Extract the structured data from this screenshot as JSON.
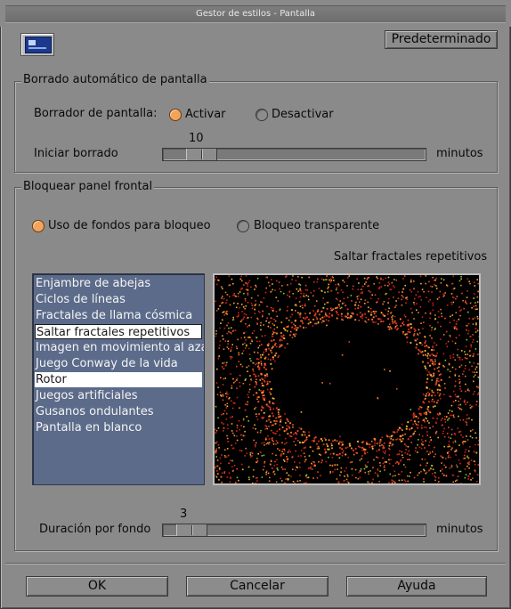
{
  "window": {
    "title": "Gestor de estilos - Pantalla"
  },
  "header": {
    "icon": "monitor-icon",
    "default_button": "Predeterminado"
  },
  "autoblank": {
    "legend": "Borrado automático de pantalla",
    "blanker_label": "Borrador de pantalla:",
    "options": [
      {
        "label": "Activar",
        "selected": true
      },
      {
        "label": "Desactivar",
        "selected": false
      }
    ],
    "start_label": "Iniciar borrado",
    "start_value": "10",
    "start_value_num": 10,
    "start_range": [
      1,
      120
    ],
    "start_unit": "minutos"
  },
  "lock": {
    "legend": "Bloquear panel frontal",
    "options": [
      {
        "label": "Uso de fondos para bloqueo",
        "selected": true
      },
      {
        "label": "Bloqueo transparente",
        "selected": false
      }
    ],
    "preview_title": "Saltar fractales repetitivos",
    "backgrounds": [
      {
        "label": "Enjambre de abejas",
        "selected": false
      },
      {
        "label": "Ciclos de líneas",
        "selected": false
      },
      {
        "label": "Fractales de llama cósmica",
        "selected": false
      },
      {
        "label": "Saltar fractales repetitivos",
        "selected": true,
        "focused": true
      },
      {
        "label": "Imagen en movimiento al azar",
        "selected": false
      },
      {
        "label": "Juego Conway de la vida",
        "selected": false
      },
      {
        "label": "Rotor",
        "selected": true
      },
      {
        "label": "Juegos artificiales",
        "selected": false
      },
      {
        "label": "Gusanos ondulantes",
        "selected": false
      },
      {
        "label": "Pantalla en blanco",
        "selected": false
      }
    ],
    "duration_label": "Duración por fondo",
    "duration_value": "3",
    "duration_value_num": 3,
    "duration_range": [
      1,
      60
    ],
    "duration_unit": "minutos"
  },
  "footer": {
    "ok": "OK",
    "cancel": "Cancelar",
    "help": "Ayuda"
  },
  "colors": {
    "window_bg": "#8a8a8a",
    "selected_radio": "#f3a35b",
    "list_bg": "#5c6b8a",
    "preview_bg": "#000000"
  }
}
